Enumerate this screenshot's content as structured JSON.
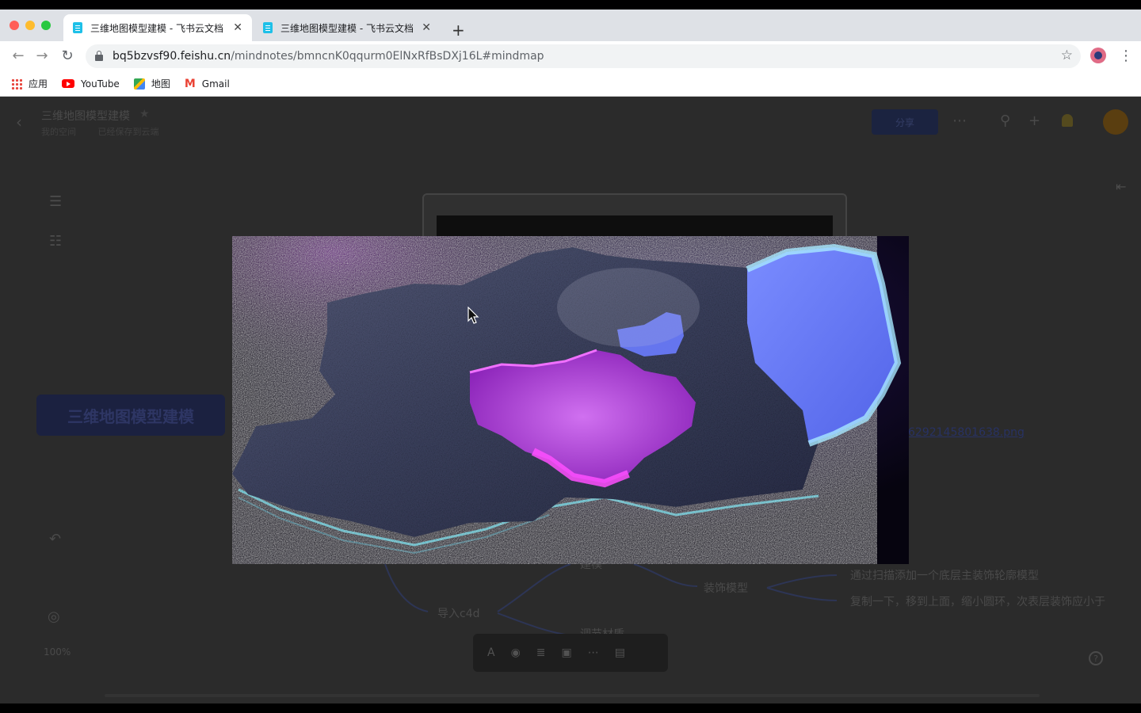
{
  "browser": {
    "tabs": [
      {
        "title": "三维地图模型建模 - 飞书云文档",
        "active": true
      },
      {
        "title": "三维地图模型建模 - 飞书云文档",
        "active": false
      }
    ],
    "new_tab_label": "+",
    "url_host": "bq5bzvsf90.feishu.cn",
    "url_path": "/mindnotes/bmncnK0qqurm0ElNxRfBsDXj16L#mindmap",
    "bookmarks": [
      {
        "label": "应用",
        "icon": "apps-grid-icon"
      },
      {
        "label": "YouTube",
        "icon": "youtube-icon"
      },
      {
        "label": "地图",
        "icon": "maps-icon"
      },
      {
        "label": "Gmail",
        "icon": "gmail-icon"
      }
    ],
    "colors": {
      "close": "#ff5f57",
      "minimize": "#febc2e",
      "maximize": "#28c840"
    }
  },
  "doc": {
    "title": "三维地图模型建模",
    "folder": "我的空间",
    "status": "已经保存到云端",
    "share_label": "分享",
    "zoom": "100%"
  },
  "mindmap": {
    "root": "三维地图模型建模",
    "nodes": {
      "import_c4d": "导入c4d",
      "modeling": "建模",
      "adjust_material": "调节材质",
      "decor_model": "装饰模型",
      "decor_detail_1": "通过扫描添加一个底层主装饰轮廓模型",
      "decor_detail_2": "复制一下，移到上面，缩小圆环，次表层装饰应小于"
    },
    "link_text": "6292145801638.png"
  },
  "viewer": {
    "accent_magenta": "#e040f0",
    "accent_cyan": "#3fe8ff",
    "accent_blue": "#6a7cff"
  }
}
